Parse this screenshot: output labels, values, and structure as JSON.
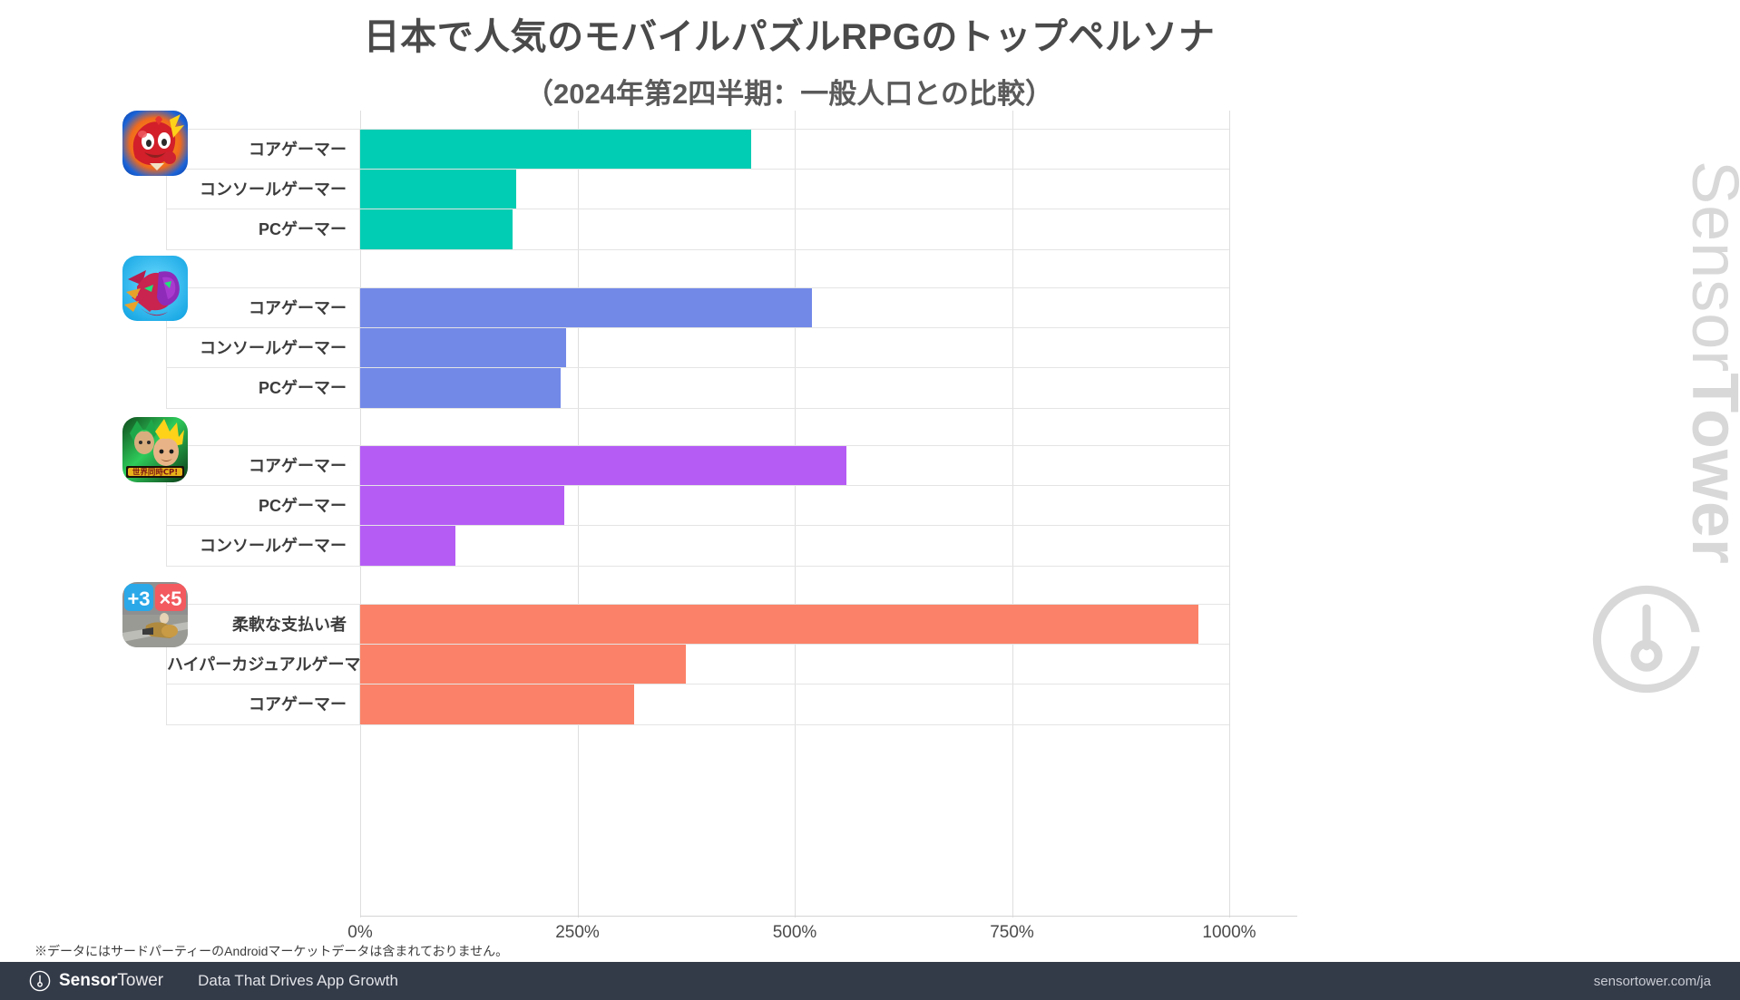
{
  "header": {
    "title": "日本で人気のモバイルパズルRPGのトップペルソナ",
    "subtitle": "（2024年第2四半期：一般人口との比較）"
  },
  "watermark": {
    "brand_light": "Sensor",
    "brand_bold": "Tower"
  },
  "footnote": "※データにはサードパーティーのAndroidマーケットデータは含まれておりません。",
  "footer": {
    "brand_bold": "Sensor",
    "brand_light": "Tower",
    "tagline": "Data That Drives App Growth",
    "url": "sensortower.com/ja"
  },
  "chart_data": {
    "type": "bar",
    "orientation": "horizontal",
    "title": "日本で人気のモバイルパズルRPGのトップペルソナ",
    "subtitle": "（2024年第2四半期：一般人口との比較）",
    "xlabel": "",
    "ylabel": "",
    "xlim": [
      0,
      1000
    ],
    "xticks": [
      0,
      250,
      500,
      750,
      1000
    ],
    "xtick_labels": [
      "0%",
      "250%",
      "500%",
      "750%",
      "1000%"
    ],
    "grid": true,
    "legend": false,
    "groups": [
      {
        "app": "monster-strike",
        "icon_name": "monster-strike-app-icon",
        "color": "#00CDB3",
        "bars": [
          {
            "label": "コアゲーマー",
            "value": 450
          },
          {
            "label": "コンソールゲーマー",
            "value": 180
          },
          {
            "label": "PCゲーマー",
            "value": 175
          }
        ]
      },
      {
        "app": "puzzle-and-dragons",
        "icon_name": "puzzle-and-dragons-app-icon",
        "color": "#7389E8",
        "bars": [
          {
            "label": "コアゲーマー",
            "value": 520
          },
          {
            "label": "コンソールゲーマー",
            "value": 237
          },
          {
            "label": "PCゲーマー",
            "value": 231
          }
        ]
      },
      {
        "app": "dragon-ball-z-dokkan-battle",
        "icon_name": "dragon-ball-dokkan-battle-app-icon",
        "color": "#B55CF5",
        "bars": [
          {
            "label": "コアゲーマー",
            "value": 560
          },
          {
            "label": "PCゲーマー",
            "value": 235
          },
          {
            "label": "コンソールゲーマー",
            "value": 110
          }
        ]
      },
      {
        "app": "puzzle-shooter",
        "icon_name": "puzzle-shooter-app-icon",
        "color": "#FB8268",
        "bars": [
          {
            "label": "柔軟な支払い者",
            "value": 965
          },
          {
            "label": "ハイパーカジュアルゲーマー",
            "value": 375
          },
          {
            "label": "コアゲーマー",
            "value": 315
          }
        ]
      }
    ]
  }
}
